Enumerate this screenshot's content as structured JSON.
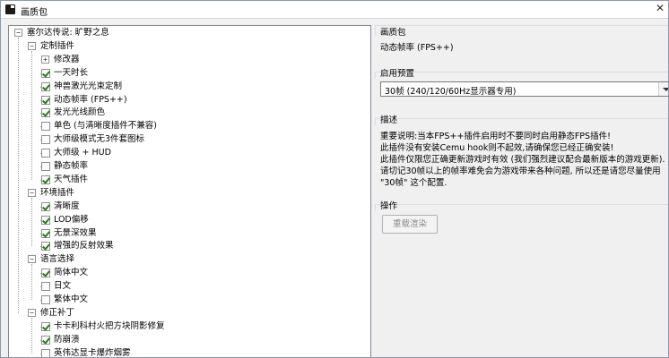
{
  "window": {
    "title": "画质包",
    "close_glyph": "✕",
    "minimize_glyph": "—"
  },
  "tree": {
    "root": "塞尔达传说: 旷野之息",
    "items": [
      {
        "label": "定制插件"
      },
      {
        "label": "修改器"
      },
      {
        "label": "一天时长",
        "checked": true
      },
      {
        "label": "神兽激光光束定制",
        "checked": true
      },
      {
        "label": "动态帧率 (FPS++)",
        "checked": true
      },
      {
        "label": "发光光线颜色",
        "checked": true
      },
      {
        "label": "单色 (与清晰度插件不兼容)",
        "checked": false
      },
      {
        "label": "大师级模式无3件套图标",
        "checked": false
      },
      {
        "label": "大师级 + HUD",
        "checked": false
      },
      {
        "label": "静态帧率",
        "checked": false
      },
      {
        "label": "天气插件",
        "checked": true
      },
      {
        "label": "环境插件"
      },
      {
        "label": "清晰度",
        "checked": true
      },
      {
        "label": "LOD偏移",
        "checked": true
      },
      {
        "label": "无景深效果",
        "checked": true
      },
      {
        "label": "增强的反射效果",
        "checked": true
      },
      {
        "label": "语言选择"
      },
      {
        "label": "简体中文",
        "checked": true
      },
      {
        "label": "日文",
        "checked": false
      },
      {
        "label": "繁体中文",
        "checked": false
      },
      {
        "label": "修正补丁"
      },
      {
        "label": "卡卡利科村火把方块阴影修复",
        "checked": true
      },
      {
        "label": "防崩溃",
        "checked": true
      },
      {
        "label": "英伟达显卡爆炸烟雾",
        "checked": false
      }
    ]
  },
  "details": {
    "heading": "画质包",
    "selected_name": "动态帧率 (FPS++)",
    "preset_label": "启用预置",
    "preset_value": "30帧 (240/120/60Hz显示器专用)",
    "description_label": "描述",
    "description_lines": [
      "重要说明:当本FPS++插件启用时不要同时启用静态FPS插件!",
      "此插件没有安装Cemu hook则不起效,请确保您已经正确安装!",
      "此插件仅限您正确更新游戏时有效 (我们强烈建议配合最新版本的游戏更新).",
      "请切记30帧以上的帧率难免会为游戏带来各种问题, 所以还是请您尽量使用",
      "\"30帧\" 这个配置."
    ],
    "operation_label": "操作",
    "reset_button": "重载渲染"
  }
}
